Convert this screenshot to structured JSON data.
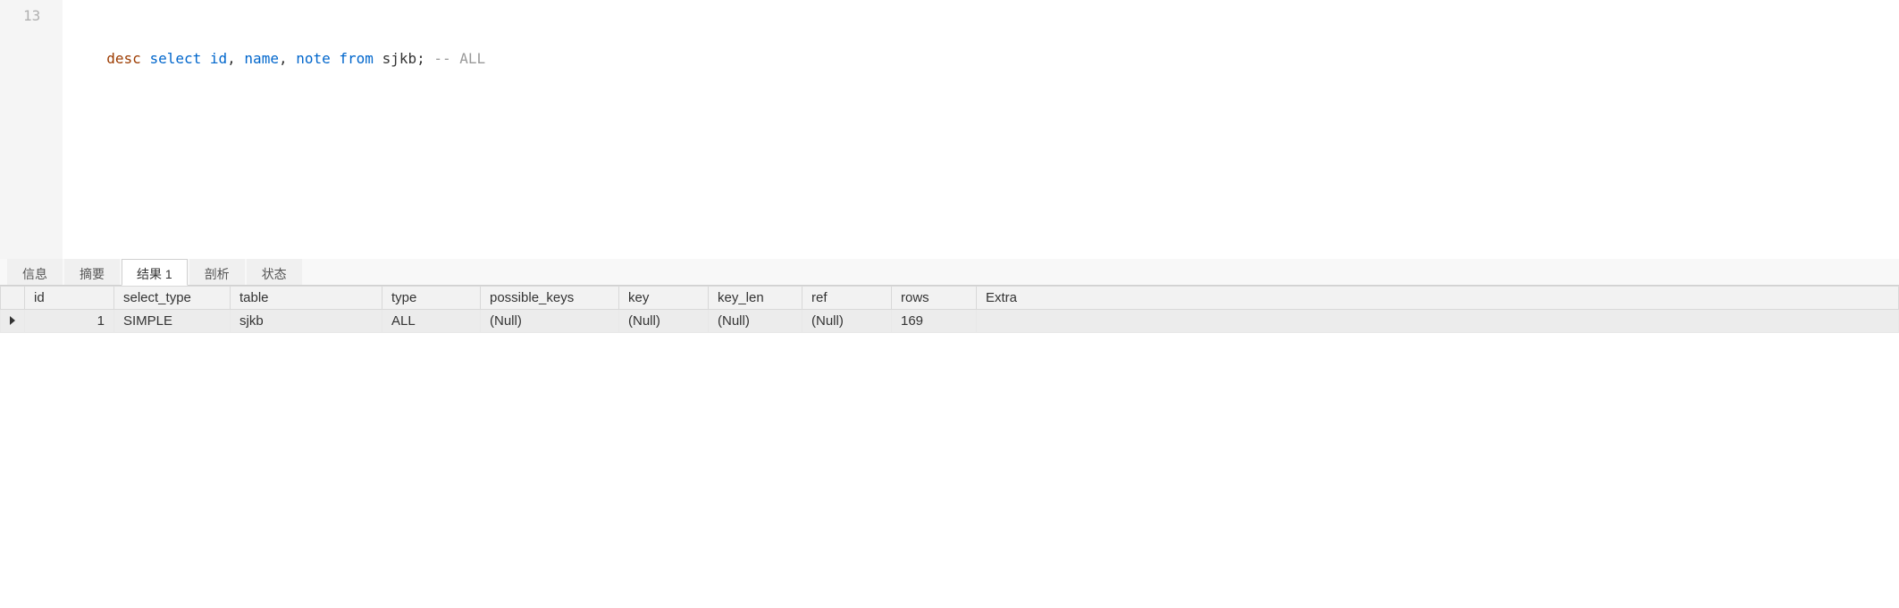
{
  "editor": {
    "line_number": "13",
    "code": {
      "desc": "desc",
      "select": "select",
      "col_id": "id",
      "comma1": ",",
      "col_name": "name",
      "comma2": ",",
      "col_note": "note",
      "from": "from",
      "table": "sjkb",
      "semicolon": ";",
      "comment": "-- ALL"
    }
  },
  "tabs": [
    {
      "label": "信息"
    },
    {
      "label": "摘要"
    },
    {
      "label": "结果 1"
    },
    {
      "label": "剖析"
    },
    {
      "label": "状态"
    }
  ],
  "active_tab_index": 2,
  "results": {
    "headers": {
      "id": "id",
      "select_type": "select_type",
      "table": "table",
      "type": "type",
      "possible_keys": "possible_keys",
      "key": "key",
      "key_len": "key_len",
      "ref": "ref",
      "rows": "rows",
      "extra": "Extra"
    },
    "row_number": "1",
    "row": {
      "id": "",
      "select_type": "SIMPLE",
      "table": "sjkb",
      "type": "ALL",
      "possible_keys": "(Null)",
      "key": "(Null)",
      "key_len": "(Null)",
      "ref": "(Null)",
      "rows": "169",
      "extra": ""
    }
  }
}
